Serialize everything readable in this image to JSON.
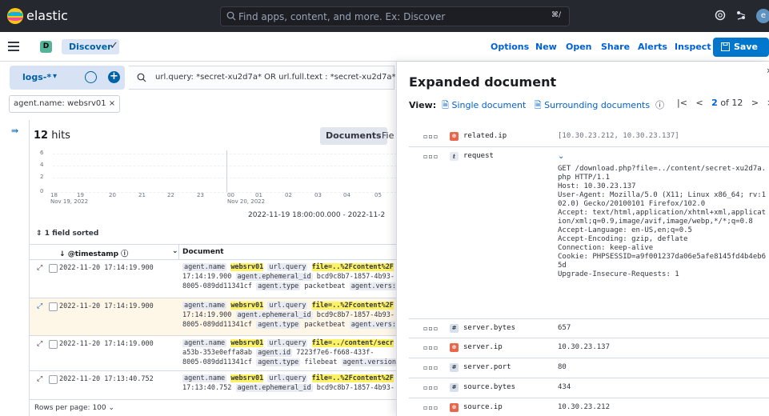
{
  "header": {
    "brand": "elastic",
    "search_placeholder": "Find apps, content, and more. Ex: Discover",
    "shortcut": "⌘/",
    "avatar": "e"
  },
  "subheader": {
    "space": "D",
    "breadcrumb": "Discover",
    "links": [
      "Options",
      "New",
      "Open",
      "Share",
      "Alerts",
      "Inspect"
    ],
    "save_label": "Save"
  },
  "query": {
    "dataview": "logs-*",
    "text": "url.query: *secret-xu2d7a* OR url.full.text : *secret-xu2d7a*",
    "filter_pill": "agent.name: websrv01 ×"
  },
  "results": {
    "hits_count": "12",
    "hits_label": "hits",
    "mode_documents": "Documents",
    "mode_fields": "Fie",
    "range": "2022-11-19 18:00:00.000 - 2022-11-2",
    "sorted": "1 field sorted",
    "col_timestamp": "@timestamp",
    "col_document": "Document",
    "rows_per_page": "Rows per page: 100",
    "y_ticks": [
      "6",
      "4",
      "2",
      "0"
    ],
    "x_ticks": [
      {
        "l1": "18",
        "l2": "Nov 19, 2022"
      },
      {
        "l1": "19",
        "l2": ""
      },
      {
        "l1": "20",
        "l2": ""
      },
      {
        "l1": "21",
        "l2": ""
      },
      {
        "l1": "22",
        "l2": ""
      },
      {
        "l1": "23",
        "l2": ""
      },
      {
        "l1": "00",
        "l2": "Nov 20, 2022"
      },
      {
        "l1": "01",
        "l2": ""
      },
      {
        "l1": "02",
        "l2": ""
      },
      {
        "l1": "03",
        "l2": ""
      },
      {
        "l1": "04",
        "l2": ""
      },
      {
        "l1": "05",
        "l2": ""
      }
    ],
    "rows": [
      {
        "ts": "2022-11-20 17:14:19.900",
        "line1": [
          {
            "t": "agent.name",
            "c": "k"
          },
          {
            "t": " "
          },
          {
            "t": "websrv01",
            "c": "hl"
          },
          {
            "t": " "
          },
          {
            "t": "url.query",
            "c": "k"
          },
          {
            "t": " "
          },
          {
            "t": "file=..%2Fcontent%2F",
            "c": "hl"
          }
        ],
        "line2": [
          {
            "t": "17:14:19.900 "
          },
          {
            "t": "agent.ephemeral_id",
            "c": "k"
          },
          {
            "t": " bcd9c8b7-1857-4b93-"
          }
        ],
        "line3": [
          {
            "t": "8005-089dd11341cf "
          },
          {
            "t": "agent.type",
            "c": "k"
          },
          {
            "t": " packetbeat "
          },
          {
            "t": "agent.vers:",
            "c": "k"
          }
        ]
      },
      {
        "ts": "2022-11-20 17:14:19.900",
        "line1": [
          {
            "t": "agent.name",
            "c": "k"
          },
          {
            "t": " "
          },
          {
            "t": "websrv01",
            "c": "hl"
          },
          {
            "t": " "
          },
          {
            "t": "url.query",
            "c": "k"
          },
          {
            "t": " "
          },
          {
            "t": "file=..%2Fcontent%2F",
            "c": "hl"
          }
        ],
        "line2": [
          {
            "t": "17:14:19.900 "
          },
          {
            "t": "agent.ephemeral_id",
            "c": "k"
          },
          {
            "t": " bcd9c8b7-1857-4b93-"
          }
        ],
        "line3": [
          {
            "t": "8005-089dd11341cf "
          },
          {
            "t": "agent.type",
            "c": "k"
          },
          {
            "t": " packetbeat "
          },
          {
            "t": "agent.vers:",
            "c": "k"
          }
        ]
      },
      {
        "ts": "2022-11-20 17:14:19.000",
        "line1": [
          {
            "t": "agent.name",
            "c": "k"
          },
          {
            "t": " "
          },
          {
            "t": "websrv01",
            "c": "hl"
          },
          {
            "t": " "
          },
          {
            "t": "url.query",
            "c": "k"
          },
          {
            "t": " "
          },
          {
            "t": "file=../content/secr",
            "c": "hl"
          }
        ],
        "line2": [
          {
            "t": "a53b-353e0effa8ab "
          },
          {
            "t": "agent.id",
            "c": "k"
          },
          {
            "t": " 7223f7e6-f668-433f-"
          }
        ],
        "line3": [
          {
            "t": "8005-089dd11341cf "
          },
          {
            "t": "agent.type",
            "c": "k"
          },
          {
            "t": " filebeat "
          },
          {
            "t": "agent.version",
            "c": "k"
          }
        ]
      },
      {
        "ts": "2022-11-20 17:13:40.752",
        "line1": [
          {
            "t": "agent.name",
            "c": "k"
          },
          {
            "t": " "
          },
          {
            "t": "websrv01",
            "c": "hl"
          },
          {
            "t": " "
          },
          {
            "t": "url.query",
            "c": "k"
          },
          {
            "t": " "
          },
          {
            "t": "file=..%2Fcontent%2F",
            "c": "hl"
          }
        ],
        "line2": [
          {
            "t": "17:13:40.752 "
          },
          {
            "t": "agent.ephemeral_id",
            "c": "k"
          },
          {
            "t": " bcd9c8b7-1857-4b93-"
          }
        ],
        "line3": []
      }
    ]
  },
  "flyout": {
    "title": "Expanded document",
    "view_label": "View:",
    "single": "Single document",
    "surrounding": "Surrounding documents",
    "page_current": "2",
    "page_of": "of 12",
    "fields": [
      {
        "name": "related.ip",
        "type": "ip",
        "value": "[10.30.23.212, 10.30.23.137]",
        "dim": true
      },
      {
        "name": "request",
        "type": "txt",
        "value": "GET /download.php?file=../content/secret-xu2d7a.php HTTP/1.1\nHost: 10.30.23.137\nUser-Agent: Mozilla/5.0 (X11; Linux x86_64; rv:102.0) Gecko/20100101 Firefox/102.0\nAccept: text/html,application/xhtml+xml,application/xml;q=0.9,image/avif,image/webp,*/*;q=0.8\nAccept-Language: en-US,en;q=0.5\nAccept-Encoding: gzip, deflate\nConnection: keep-alive\nCookie: PHPSESSID=a9f001237da06e5afe8145fd4b4eb65d\nUpgrade-Insecure-Requests: 1"
      },
      {
        "name": "server.bytes",
        "type": "num",
        "value": "657"
      },
      {
        "name": "server.ip",
        "type": "ip",
        "value": "10.30.23.137"
      },
      {
        "name": "server.port",
        "type": "num",
        "value": "80"
      },
      {
        "name": "source.bytes",
        "type": "num",
        "value": "434"
      },
      {
        "name": "source.ip",
        "type": "ip",
        "value": "10.30.23.212"
      }
    ]
  }
}
